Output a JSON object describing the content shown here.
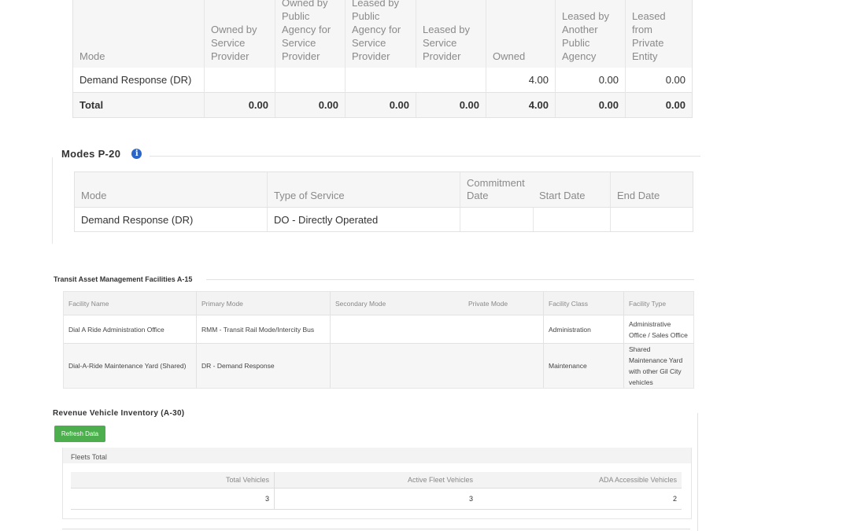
{
  "ownership": {
    "headers": [
      "Mode",
      "Owned by Service Provider",
      "Owned by Public Agency for Service Provider",
      "Leased by Public Agency for Service Provider",
      "Leased by Service Provider",
      "Owned",
      "Leased by Another Public Agency",
      "Leased from Private Entity"
    ],
    "rows": [
      [
        "Demand Response (DR)",
        "",
        "",
        "",
        "",
        "4.00",
        "0.00",
        "0.00"
      ]
    ],
    "total": [
      "Total",
      "0.00",
      "0.00",
      "0.00",
      "0.00",
      "4.00",
      "0.00",
      "0.00"
    ]
  },
  "modes": {
    "title": "Modes P-20",
    "info_icon": "info-icon",
    "headers": [
      "Mode",
      "Type of Service",
      "Commitment Date",
      "Start Date",
      "End Date"
    ],
    "rows": [
      [
        "Demand Response (DR)",
        "DO - Directly Operated",
        "",
        "",
        ""
      ]
    ]
  },
  "facilities": {
    "title": "Transit Asset Management Facilities A-15",
    "headers": [
      "Facility Name",
      "Primary Mode",
      "Secondary Mode",
      "Private Mode",
      "Facility Class",
      "Facility Type"
    ],
    "rows": [
      [
        "Dial A Ride Administration Office",
        "RMM - Transit Rail Mode/Intercity Bus",
        "",
        "",
        "Administration",
        "Administrative Office / Sales Office"
      ],
      [
        "Dial-A-Ride Maintenance Yard (Shared)",
        "DR - Demand Response",
        "",
        "",
        "Maintenance",
        "Shared Maintenance Yard with other Gil City vehicles"
      ]
    ]
  },
  "inventory": {
    "title": "Revenue Vehicle Inventory (A-30)",
    "refresh_label": "Refresh Data",
    "accent_color": "#4cae4c",
    "panel_title": "Fleets Total",
    "headers": [
      "Total Vehicles",
      "Active Fleet Vehicles",
      "ADA Accessible Vehicles"
    ],
    "values": [
      "3",
      "3",
      "2"
    ]
  }
}
